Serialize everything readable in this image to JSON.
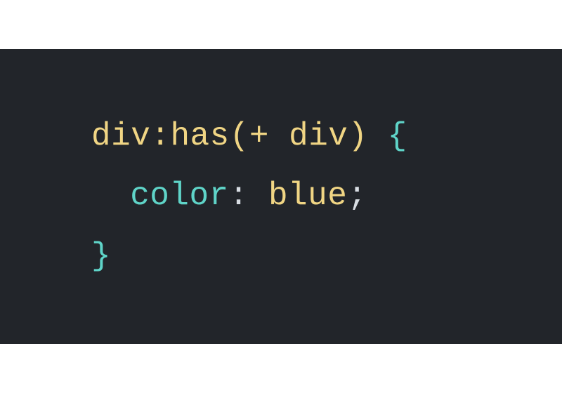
{
  "code": {
    "line1": {
      "selector_tag1": "div",
      "pseudo_colon": ":",
      "pseudo_name": "has",
      "paren_open": "(",
      "combinator": "+ ",
      "selector_tag2": "div",
      "paren_close": ")",
      "space": " ",
      "brace_open": "{"
    },
    "line2": {
      "property": "color",
      "colon": ":",
      "space": " ",
      "value": "blue",
      "semicolon": ";"
    },
    "line3": {
      "brace_close": "}"
    }
  },
  "colors": {
    "background": "#22252a",
    "yellow": "#f0d584",
    "teal": "#5fd4c8",
    "white": "#d8dde3"
  }
}
